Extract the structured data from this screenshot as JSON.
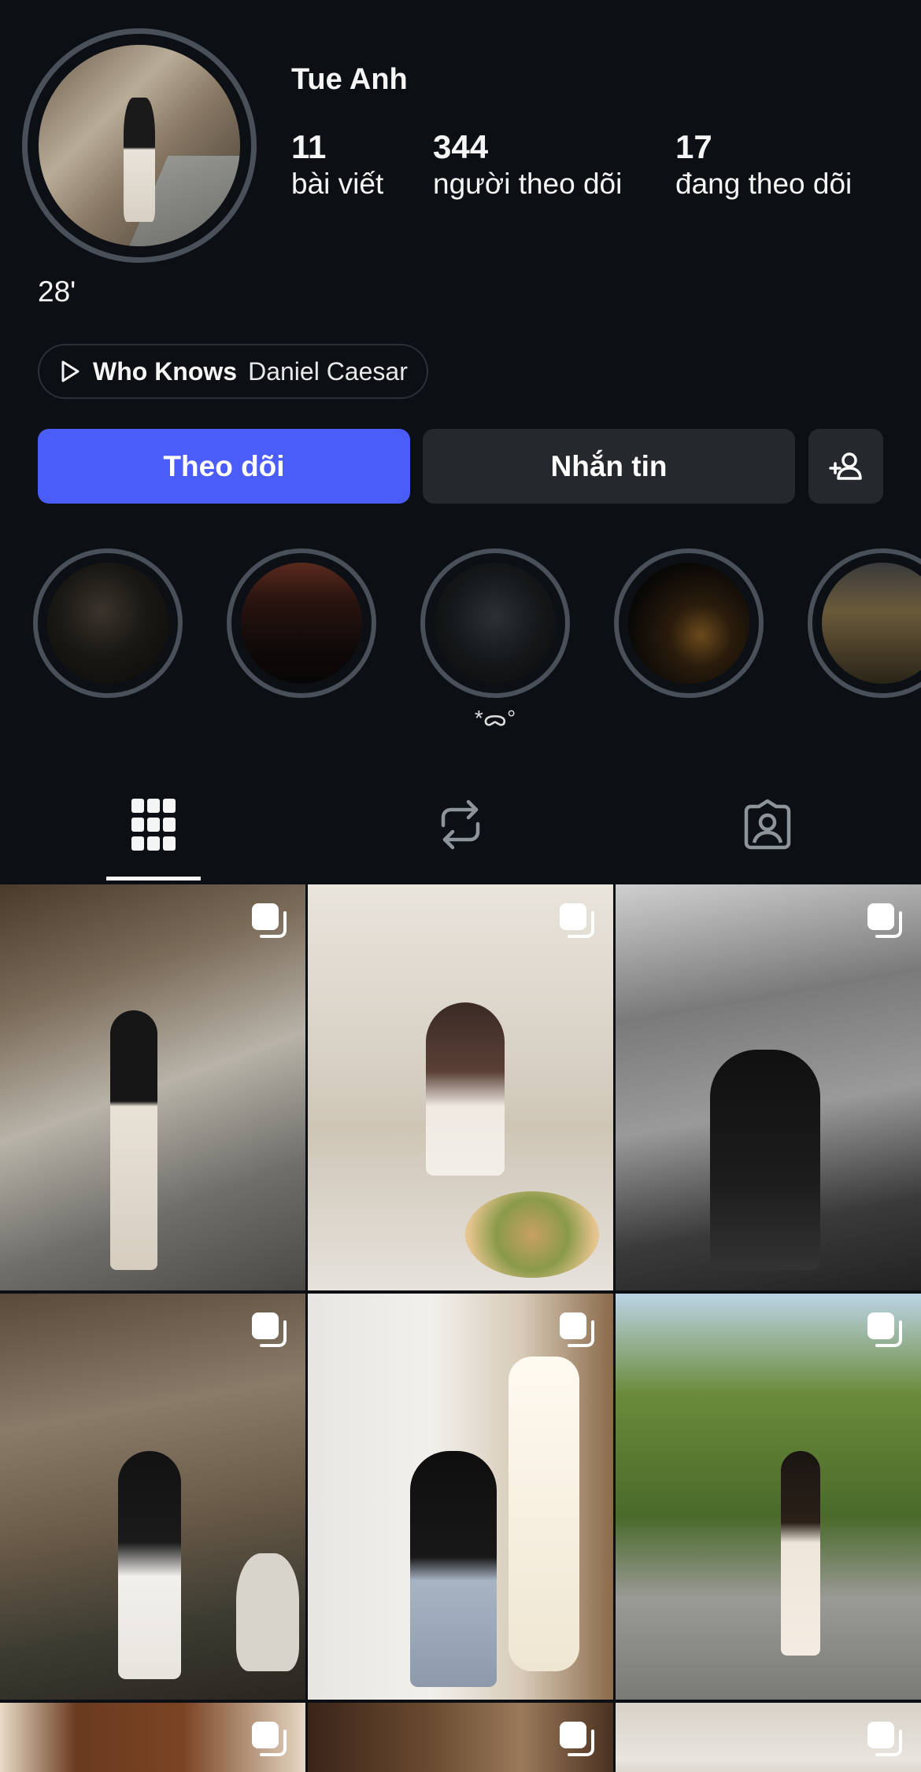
{
  "profile": {
    "username": "Tue Anh",
    "bio": "28'",
    "stats": [
      {
        "value": "11",
        "label": "bài viết"
      },
      {
        "value": "344",
        "label": "người theo dõi"
      },
      {
        "value": "17",
        "label": "đang theo dõi"
      }
    ],
    "music": {
      "song": "Who Knows",
      "artist": "Daniel Caesar",
      "icon": "play-icon"
    }
  },
  "actions": {
    "follow_label": "Theo dõi",
    "message_label": "Nhắn tin",
    "add_friend_icon": "add-person-icon"
  },
  "highlights": [
    {
      "label": ""
    },
    {
      "label": ""
    },
    {
      "label": "*ᯅ°"
    },
    {
      "label": ""
    },
    {
      "label": ""
    }
  ],
  "tabs": [
    {
      "icon": "grid-icon",
      "active": true
    },
    {
      "icon": "reposts-icon",
      "active": false
    },
    {
      "icon": "tagged-icon",
      "active": false
    }
  ],
  "colors": {
    "background": "#0c1014",
    "primary_button": "#4a5df9",
    "secondary_button": "#25292e",
    "ring": "#4a5059"
  }
}
